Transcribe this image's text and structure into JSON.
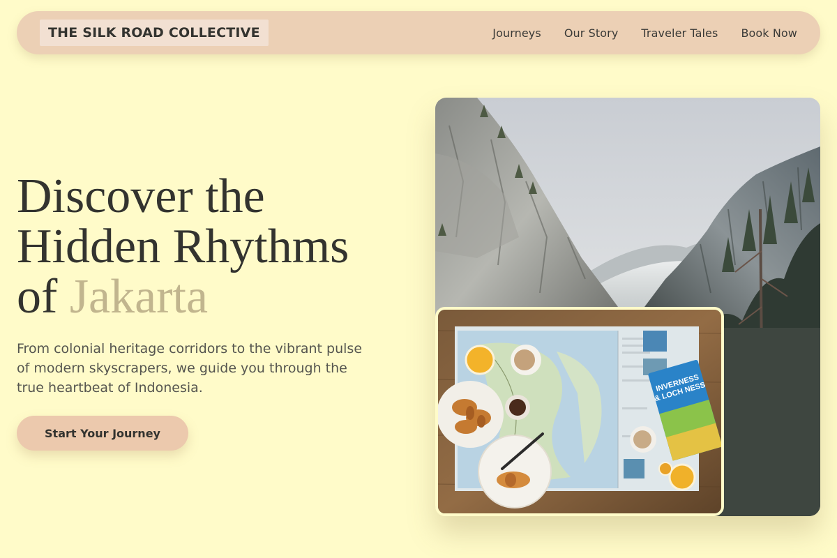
{
  "nav": {
    "brand": "THE SILK ROAD COLLECTIVE",
    "links": [
      "Journeys",
      "Our Story",
      "Traveler Tales",
      "Book Now"
    ]
  },
  "hero": {
    "title_line1": "Discover the",
    "title_line2": "Hidden Rhythms",
    "title_of": "of",
    "title_accent": "Jakarta",
    "subtitle": "From colonial heritage corridors to the vibrant pulse of modern skyscrapers, we guide you through the true heartbeat of Indonesia.",
    "cta_label": "Start Your Journey"
  },
  "images": {
    "main_photo": "mountain-valley-photo",
    "inset_photo": "travel-map-breakfast-photo",
    "guidebook_title_line1": "INVERNESS",
    "guidebook_title_line2": "& LOCH NESS"
  },
  "colors": {
    "background": "#fffbc9",
    "nav_bg": "#ecd0b5",
    "accent_text": "#c1b58e",
    "cta_bg": "#ecc9ad"
  }
}
